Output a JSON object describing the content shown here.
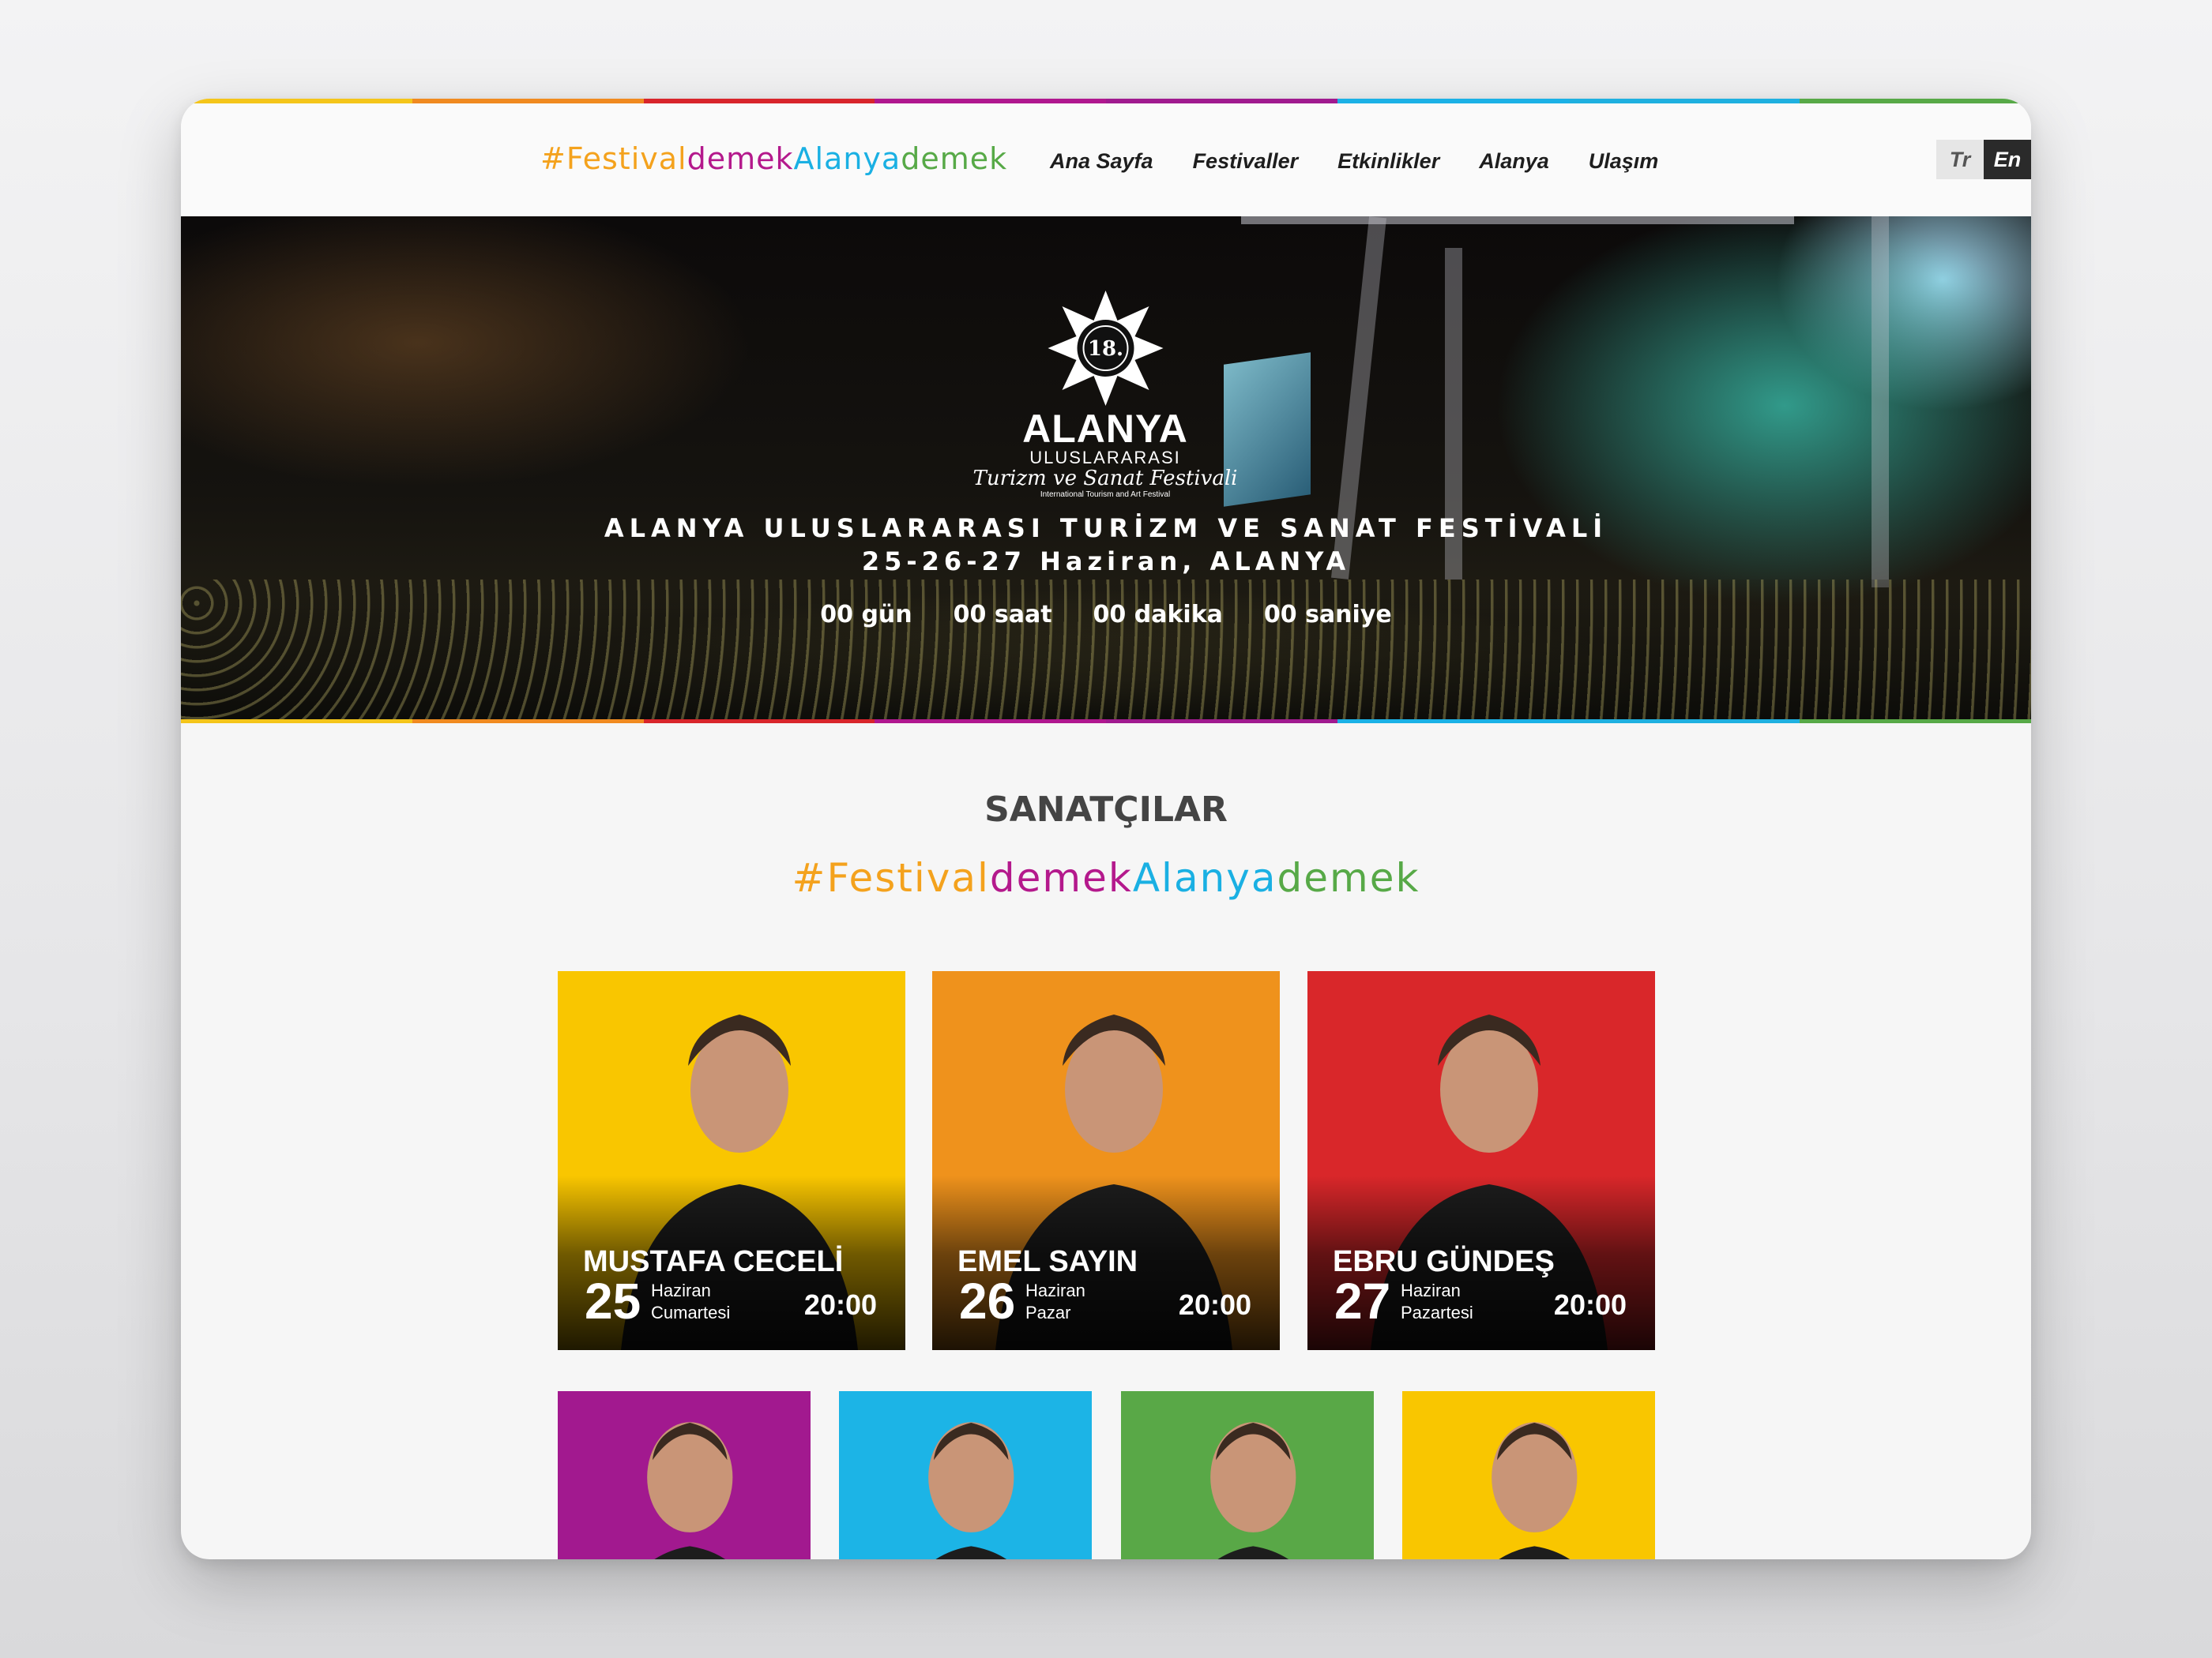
{
  "stripe_colors": [
    "#f4c51a",
    "#f08a20",
    "#d8252b",
    "#b0178f",
    "#a01a8f",
    "#1bb1e6",
    "#1fb0e0",
    "#57a947"
  ],
  "brand": {
    "parts": [
      {
        "text": "#Festival",
        "color": "#f4a21d"
      },
      {
        "text": "demek",
        "color": "#b4198c"
      },
      {
        "text": "Alanya",
        "color": "#1ab0e3"
      },
      {
        "text": "demek",
        "color": "#57a947"
      }
    ]
  },
  "nav": {
    "items": [
      "Ana Sayfa",
      "Festivaller",
      "Etkinlikler",
      "Alanya",
      "Ulaşım"
    ]
  },
  "lang": {
    "tr": "Tr",
    "en": "En"
  },
  "hero": {
    "logo_badge": "18.",
    "logo_main": "ALANYA",
    "logo_sub": "ULUSLARARASI",
    "logo_script": "Turizm ve Sanat Festivali",
    "logo_tiny": "International Tourism and Art Festival",
    "title": "ALANYA ULUSLARARASI TURİZM VE SANAT FESTİVALİ",
    "date": "25-26-27 Haziran, ALANYA",
    "countdown": [
      "00 gün",
      "00 saat",
      "00 dakika",
      "00 saniye"
    ]
  },
  "section": {
    "title": "SANATÇILAR",
    "tag_parts": [
      {
        "text": "#Festival",
        "color": "#f4a21d"
      },
      {
        "text": "demek",
        "color": "#b4198c"
      },
      {
        "text": "Alanya",
        "color": "#1ab0e3"
      },
      {
        "text": "demek",
        "color": "#57a947"
      }
    ]
  },
  "artists": [
    {
      "name": "MUSTAFA CECELİ",
      "day": "25",
      "month": "Haziran",
      "weekday": "Cumartesi",
      "time": "20:00",
      "bg": "#f9c600"
    },
    {
      "name": "EMEL SAYIN",
      "day": "26",
      "month": "Haziran",
      "weekday": "Pazar",
      "time": "20:00",
      "bg": "#ef921c"
    },
    {
      "name": "EBRU GÜNDEŞ",
      "day": "27",
      "month": "Haziran",
      "weekday": "Pazartesi",
      "time": "20:00",
      "bg": "#d9272a"
    }
  ],
  "artists_row2": [
    {
      "bg": "#a2198f"
    },
    {
      "bg": "#1cb4e6"
    },
    {
      "bg": "#59a847"
    },
    {
      "bg": "#f9c600"
    }
  ]
}
